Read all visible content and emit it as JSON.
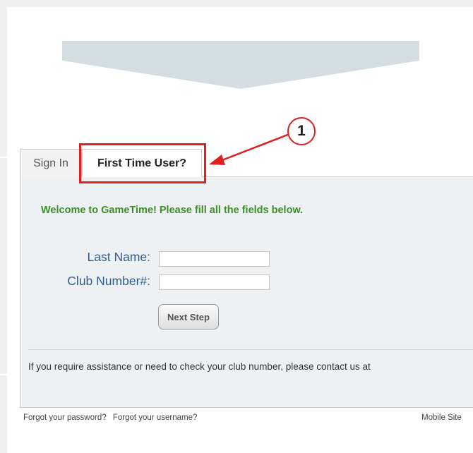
{
  "tabs": {
    "sign_in": "Sign In",
    "first_time_user": "First Time User?"
  },
  "callout": {
    "number": "1"
  },
  "form": {
    "welcome_message": "Welcome to GameTime! Please fill all the fields below.",
    "last_name_label": "Last Name:",
    "last_name_value": "",
    "club_number_label": "Club Number#:",
    "club_number_value": "",
    "next_button": "Next Step",
    "assistance_text": "If you require assistance or need to check your club number, please contact us at"
  },
  "footer": {
    "forgot_password": "Forgot your password?",
    "forgot_username": "Forgot your username?",
    "mobile_site": "Mobile Site"
  },
  "colors": {
    "highlight": "#e02020",
    "welcome_text": "#3b8f26",
    "label_text": "#2e5e95",
    "panel_bg": "#edf1f3",
    "banner": "#d3dde2"
  }
}
